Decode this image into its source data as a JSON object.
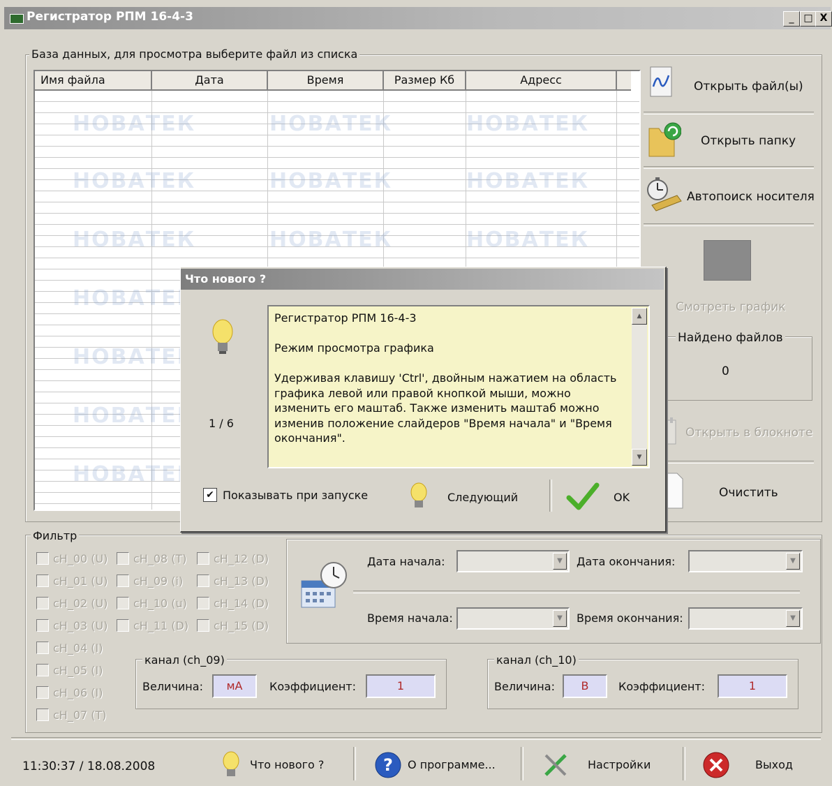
{
  "window": {
    "title": "Регистратор РПМ 16-4-3",
    "controls": [
      "_",
      "□",
      "X"
    ]
  },
  "database": {
    "group_label": "База данных, для просмотра выберите файл из списка",
    "columns": [
      "Имя файла",
      "Дата",
      "Время",
      "Размер Кб",
      "Адресс"
    ],
    "rows": [],
    "watermark_text": "НОВАТЕК"
  },
  "sidebar": {
    "open_files": "Открыть файл(ы)",
    "open_folder": "Открыть папку",
    "auto_search": "Автопоиск носителя",
    "view_graph": "Смотреть график",
    "found_files_label": "Найдено файлов",
    "found_files_count": "0",
    "open_notepad": "Открыть в блокноте",
    "clear": "Очистить"
  },
  "filter": {
    "group_label": "Фильтр",
    "channels": [
      "cH_00 (U)",
      "cH_01 (U)",
      "cH_02 (U)",
      "cH_03 (U)",
      "cH_04 (I)",
      "cH_05 (I)",
      "cH_06 (I)",
      "cH_07 (T)",
      "cH_08 (T)",
      "cH_09 (i)",
      "cH_10 (u)",
      "cH_11 (D)",
      "cH_12 (D)",
      "cH_13 (D)",
      "cH_14 (D)",
      "cH_15 (D)"
    ],
    "date_start_label": "Дата начала:",
    "date_end_label": "Дата окончания:",
    "time_start_label": "Время начала:",
    "time_end_label": "Время окончания:",
    "ch09": {
      "group_label": "канал (ch_09)",
      "quantity_label": "Величина:",
      "quantity_value": "мА",
      "coef_label": "Коэффициент:",
      "coef_value": "1"
    },
    "ch10": {
      "group_label": "канал (ch_10)",
      "quantity_label": "Величина:",
      "quantity_value": "В",
      "coef_label": "Коэффициент:",
      "coef_value": "1"
    }
  },
  "statusbar": {
    "datetime": "11:30:37 / 18.08.2008",
    "whats_new": "Что нового ?",
    "about": "О программе...",
    "settings": "Настройки",
    "exit": "Выход"
  },
  "dialog": {
    "title": "Что нового ?",
    "page": "1 / 6",
    "text_title": "Регистратор РПМ 16-4-3",
    "text_mode": "Режим просмотра графика",
    "text_body": "Удерживая клавишу 'Ctrl', двойным нажатием на область графика левой или правой кнопкой мыши, можно изменить его маштаб. Также изменить маштаб можно изменив положение слайдеров \"Время начала\" и \"Время окончания\".",
    "show_on_start": "Показывать при запуске",
    "show_on_start_checked": true,
    "next": "Следующий",
    "ok": "OK"
  },
  "colors": {
    "window_bg": "#d8d5cc",
    "memo_bg": "#f6f4c8",
    "field_bg": "#dcdcf4",
    "check_green": "#4caf2a",
    "exit_red": "#cc2a2a",
    "info_blue": "#2a5bbf"
  }
}
